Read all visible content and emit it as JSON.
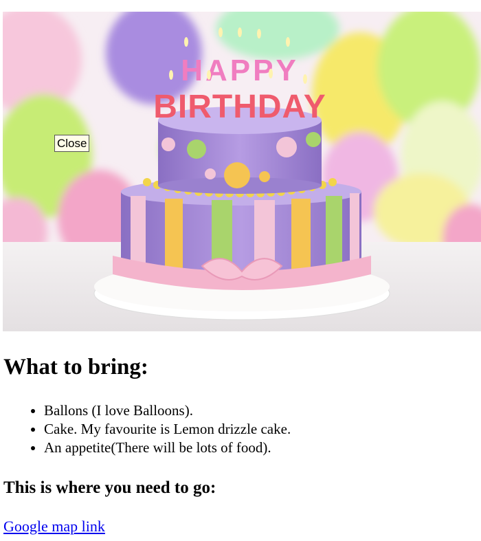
{
  "hero": {
    "image_alt": "Birthday cake with candles spelling HAPPY BIRTHDAY in front of pastel balloons",
    "candle_top_text": "HAPPY",
    "candle_bottom_text": "BIRTHDAY",
    "close_button_label": "Close"
  },
  "bring": {
    "heading": "What to bring:",
    "items": [
      "Ballons (I love Balloons).",
      "Cake. My favourite is Lemon drizzle cake.",
      "An appetite(There will be lots of food)."
    ]
  },
  "where": {
    "heading": "This is where you need to go:",
    "map_link_label": "Google map link"
  }
}
